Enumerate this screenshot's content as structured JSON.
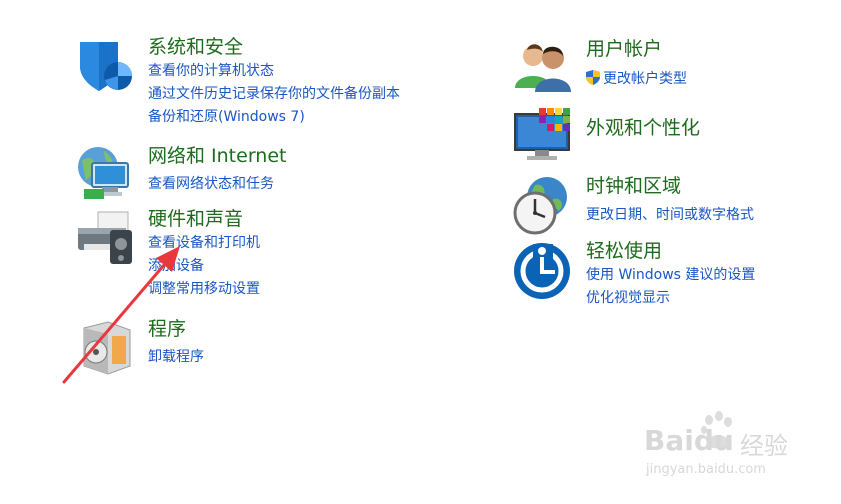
{
  "categories": {
    "system": {
      "title": "系统和安全",
      "links": [
        "查看你的计算机状态",
        "通过文件历史记录保存你的文件备份副本",
        "备份和还原(Windows 7)"
      ]
    },
    "network": {
      "title": "网络和 Internet",
      "links": [
        "查看网络状态和任务"
      ]
    },
    "hardware": {
      "title": "硬件和声音",
      "links": [
        "查看设备和打印机",
        "添加设备",
        "调整常用移动设置"
      ]
    },
    "programs": {
      "title": "程序",
      "links": [
        "卸载程序"
      ]
    },
    "user": {
      "title": "用户帐户",
      "links": [
        "更改帐户类型"
      ]
    },
    "appearance": {
      "title": "外观和个性化",
      "links": []
    },
    "clock": {
      "title": "时钟和区域",
      "links": [
        "更改日期、时间或数字格式"
      ]
    },
    "ease": {
      "title": "轻松使用",
      "links": [
        "使用 Windows 建议的设置",
        "优化视觉显示"
      ]
    }
  },
  "icons": {
    "system": "security-shield-icon",
    "network": "network-globe-icon",
    "hardware": "printer-icon",
    "programs": "programs-disc-icon",
    "user": "user-accounts-icon",
    "appearance": "appearance-monitor-icon",
    "clock": "clock-globe-icon",
    "ease": "ease-of-access-icon",
    "uac": "uac-shield-icon",
    "annotation": "red-arrow-annotation"
  },
  "watermark": {
    "brand": "Baidu",
    "brand_cn": "经验",
    "url": "jingyan.baidu.com"
  },
  "colors": {
    "title": "#1e6b1e",
    "link": "#1a56c4",
    "annotation": "#e8383d"
  }
}
